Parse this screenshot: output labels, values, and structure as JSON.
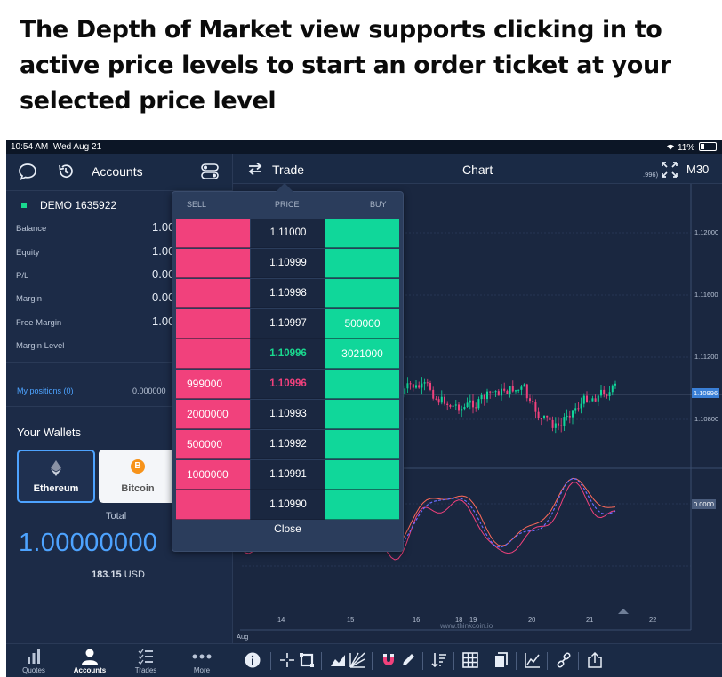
{
  "caption": "The Depth of Market view supports clicking in to active price levels to start an order ticket at your selected price level",
  "status_bar": {
    "time": "10:54 AM",
    "date": "Wed Aug 21",
    "battery": "11%"
  },
  "left_panel": {
    "title": "Accounts",
    "account_name": "DEMO 1635922",
    "rows": [
      {
        "label": "Balance",
        "value": "1.00"
      },
      {
        "label": "Equity",
        "value": "1.00"
      },
      {
        "label": "P/L",
        "value": "0.00"
      },
      {
        "label": "Margin",
        "value": "0.00"
      },
      {
        "label": "Free Margin",
        "value": "1.00"
      },
      {
        "label": "Margin Level",
        "value": ""
      }
    ],
    "positions_label": "My positions (0)",
    "positions_value": "0.000000",
    "wallets_title": "Your Wallets",
    "wallets": [
      {
        "name": "Ethereum",
        "icon": "ethereum-icon"
      },
      {
        "name": "Bitcoin",
        "icon": "bitcoin-icon",
        "glyph": "B"
      }
    ],
    "total_label": "Total",
    "total_value": "1.00000000",
    "total_usd_amount": "183.15",
    "total_usd_unit": "USD"
  },
  "chart_header": {
    "trade_label": "Trade",
    "chart_title": "Chart",
    "timeframe": "M30",
    "series_label_partial": ".996)"
  },
  "price_axis": [
    "1.12000",
    "1.11600",
    "1.11200",
    "1.10996",
    "1.10800",
    "0.0000"
  ],
  "time_axis": [
    "14",
    "15",
    "16",
    "18",
    "19",
    "20",
    "21",
    "22"
  ],
  "month_label": "Aug",
  "watermark": "www.thinkcoin.io",
  "dom": {
    "headers": {
      "sell": "SELL",
      "price": "PRICE",
      "buy": "BUY"
    },
    "rows": [
      {
        "sell": "",
        "price": "1.11000",
        "buy": "",
        "kind": ""
      },
      {
        "sell": "",
        "price": "1.10999",
        "buy": "",
        "kind": ""
      },
      {
        "sell": "",
        "price": "1.10998",
        "buy": "",
        "kind": ""
      },
      {
        "sell": "",
        "price": "1.10997",
        "buy": "500000",
        "kind": ""
      },
      {
        "sell": "",
        "price": "1.10996",
        "buy": "3021000",
        "kind": "bid"
      },
      {
        "sell": "999000",
        "price": "1.10996",
        "buy": "",
        "kind": "ask"
      },
      {
        "sell": "2000000",
        "price": "1.10993",
        "buy": "",
        "kind": ""
      },
      {
        "sell": "500000",
        "price": "1.10992",
        "buy": "",
        "kind": ""
      },
      {
        "sell": "1000000",
        "price": "1.10991",
        "buy": "",
        "kind": ""
      },
      {
        "sell": "",
        "price": "1.10990",
        "buy": "",
        "kind": ""
      }
    ],
    "close_label": "Close"
  },
  "bottom_tabs": [
    {
      "label": "Quotes",
      "icon": "quotes-icon"
    },
    {
      "label": "Accounts",
      "icon": "accounts-icon",
      "active": true
    },
    {
      "label": "Trades",
      "icon": "trades-icon"
    },
    {
      "label": "More",
      "icon": "more-icon"
    }
  ],
  "colors": {
    "sell": "#f1417c",
    "buy": "#10d79a",
    "accent": "#4da3ff",
    "background": "#16233a"
  }
}
